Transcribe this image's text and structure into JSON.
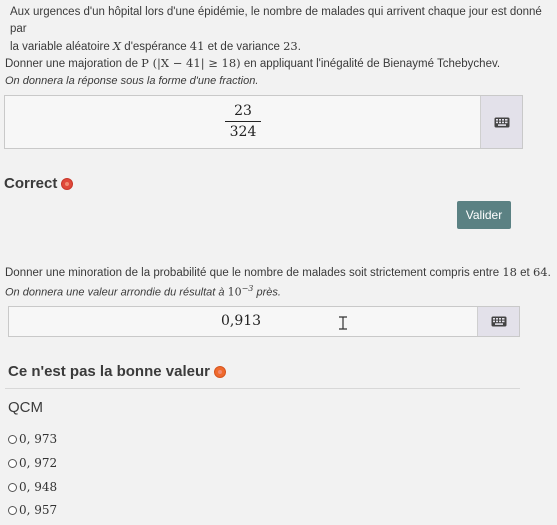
{
  "intro": {
    "line1": "Aux urgences d'un hôpital lors d'une épidémie, le nombre de malades qui arrivent chaque jour est donné par",
    "line2_prefix": "la variable aléatoire ",
    "line2_var": "X",
    "line2_mid": " d'espérance ",
    "expectation": "41",
    "line2_mid2": " et de variance ",
    "variance": "23",
    "line2_end": "."
  },
  "question1": {
    "prefix": "Donner une majoration de ",
    "formula": "P (|X − 41| ≥ 18)",
    "suffix": " en appliquant l'inégalité de Bienaymé Tchebychev.",
    "instruction": "On donnera la réponse sous la forme d'une fraction.",
    "answer_numerator": "23",
    "answer_denominator": "324",
    "feedback": "Correct"
  },
  "valider_label": "Valider",
  "question2": {
    "text_prefix": "Donner une minoration de la probabilité que le nombre de malades soit strictement compris entre ",
    "low": "18",
    "text_mid": " et ",
    "high": "64",
    "text_end": ".",
    "instruction_prefix": "On donnera une valeur arrondie du résultat à ",
    "precision": "10",
    "precision_exp": "−3",
    "instruction_suffix": " près.",
    "answer_value": "0,913",
    "feedback": "Ce n'est pas la bonne valeur"
  },
  "qcm": {
    "title": "QCM",
    "options": [
      "0, 973",
      "0, 972",
      "0, 948",
      "0, 957"
    ]
  },
  "colors": {
    "valider_bg": "#5b8183",
    "correct_dot": "#e0483a",
    "wrong_dot": "#ef6a2e",
    "keyboard_panel": "#e3e1ea"
  },
  "icons": {
    "keyboard": "keyboard-icon",
    "status": "status-dot-icon",
    "cursor": "text-cursor-icon"
  }
}
